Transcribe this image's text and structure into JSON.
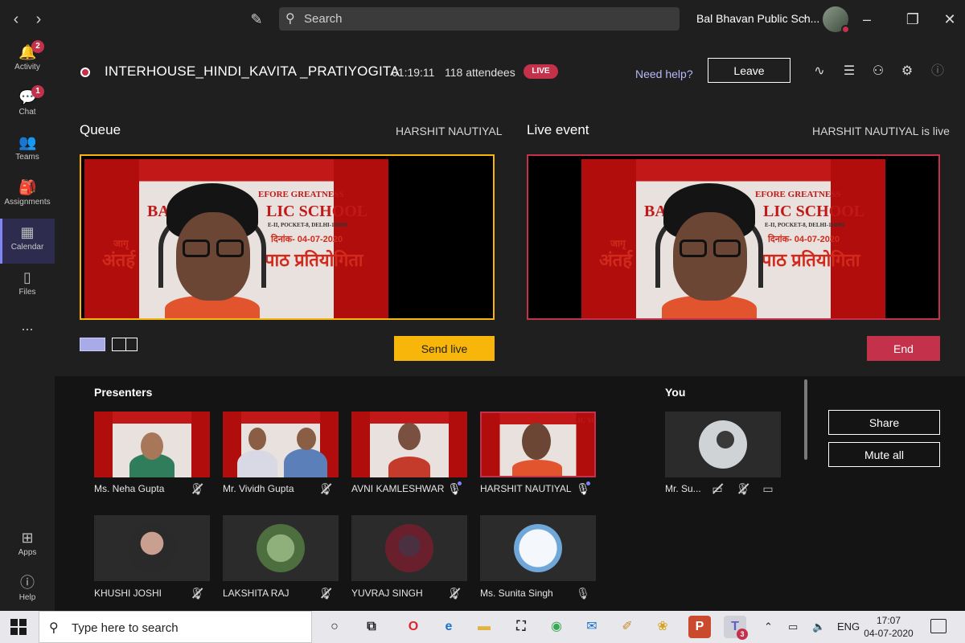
{
  "titlebar": {
    "search_placeholder": "Search",
    "org_name": "Bal Bhavan Public Sch...",
    "back_icon": "chevron-left-icon",
    "forward_icon": "chevron-right-icon"
  },
  "rail": {
    "items": [
      {
        "label": "Activity",
        "icon": "bell-icon",
        "badge": "2"
      },
      {
        "label": "Chat",
        "icon": "chat-icon",
        "badge": "1"
      },
      {
        "label": "Teams",
        "icon": "teams-icon"
      },
      {
        "label": "Assignments",
        "icon": "assignments-icon"
      },
      {
        "label": "Calendar",
        "icon": "calendar-icon"
      },
      {
        "label": "Files",
        "icon": "file-icon"
      },
      {
        "label": "Apps",
        "icon": "apps-icon"
      },
      {
        "label": "Help",
        "icon": "help-icon"
      }
    ],
    "more_label": "..."
  },
  "meeting": {
    "title": "INTERHOUSE_HINDI_KAVITA _PRATIYOGITA",
    "elapsed": "01:19:11",
    "attendees": "118 attendees",
    "live_badge": "LIVE",
    "need_help": "Need help?",
    "leave_label": "Leave"
  },
  "queue": {
    "title": "Queue",
    "presenter": "HARSHIT NAUTIYAL",
    "send_live_label": "Send live"
  },
  "live_event": {
    "title": "Live event",
    "status": "HARSHIT NAUTIYAL is live",
    "end_label": "End"
  },
  "banner": {
    "line1": "EFORE GREATNESS",
    "school_a": "BA",
    "school_b": "LIC SCHOOL",
    "address": "E-II, POCKET-8, DELHI-110091",
    "date": "दिनांक- 04-07-2020",
    "hindi_a": "अंतर्ह",
    "hindi_b": "पाठ प्रतियोगिता",
    "hindi_small": "जागृ"
  },
  "presenters": {
    "title": "Presenters",
    "row1": [
      {
        "name": "Ms. Neha Gupta",
        "mic": "off"
      },
      {
        "name": "Mr. Vividh Gupta",
        "mic": "off"
      },
      {
        "name": "AVNI KAMLESHWAR",
        "mic": "on"
      },
      {
        "name": "HARSHIT NAUTIYAL",
        "mic": "on"
      }
    ],
    "row2": [
      {
        "name": "KHUSHI JOSHI",
        "mic": "off"
      },
      {
        "name": "LAKSHITA RAJ",
        "mic": "off"
      },
      {
        "name": "YUVRAJ SINGH",
        "mic": "off"
      },
      {
        "name": "Ms. Sunita Singh",
        "mic": "on-plain"
      }
    ],
    "tile_banner": "BAL BHAVAN PUBLIC SCHOOL"
  },
  "you": {
    "title": "You",
    "name": "Mr. Su...",
    "share_label": "Share",
    "mute_all_label": "Mute all"
  },
  "taskbar": {
    "search_placeholder": "Type here to search",
    "language": "ENG",
    "time": "17:07",
    "date": "04-07-2020",
    "teams_badge": "3"
  },
  "colors": {
    "accent": "#7f85f5",
    "live_red": "#c4314b",
    "queue_yellow": "#f8b60a",
    "background": "#1f1f1f"
  }
}
